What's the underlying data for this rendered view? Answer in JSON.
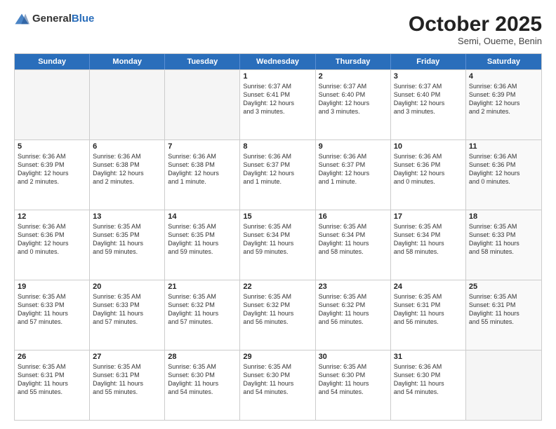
{
  "header": {
    "logo": {
      "general": "General",
      "blue": "Blue"
    },
    "month": "October 2025",
    "location": "Semi, Oueme, Benin"
  },
  "weekdays": [
    "Sunday",
    "Monday",
    "Tuesday",
    "Wednesday",
    "Thursday",
    "Friday",
    "Saturday"
  ],
  "rows": [
    [
      {
        "day": "",
        "empty": true,
        "info": ""
      },
      {
        "day": "",
        "empty": true,
        "info": ""
      },
      {
        "day": "",
        "empty": true,
        "info": ""
      },
      {
        "day": "1",
        "empty": false,
        "info": "Sunrise: 6:37 AM\nSunset: 6:41 PM\nDaylight: 12 hours\nand 3 minutes."
      },
      {
        "day": "2",
        "empty": false,
        "info": "Sunrise: 6:37 AM\nSunset: 6:40 PM\nDaylight: 12 hours\nand 3 minutes."
      },
      {
        "day": "3",
        "empty": false,
        "info": "Sunrise: 6:37 AM\nSunset: 6:40 PM\nDaylight: 12 hours\nand 3 minutes."
      },
      {
        "day": "4",
        "empty": false,
        "shade": true,
        "info": "Sunrise: 6:36 AM\nSunset: 6:39 PM\nDaylight: 12 hours\nand 2 minutes."
      }
    ],
    [
      {
        "day": "5",
        "empty": false,
        "info": "Sunrise: 6:36 AM\nSunset: 6:39 PM\nDaylight: 12 hours\nand 2 minutes."
      },
      {
        "day": "6",
        "empty": false,
        "info": "Sunrise: 6:36 AM\nSunset: 6:38 PM\nDaylight: 12 hours\nand 2 minutes."
      },
      {
        "day": "7",
        "empty": false,
        "info": "Sunrise: 6:36 AM\nSunset: 6:38 PM\nDaylight: 12 hours\nand 1 minute."
      },
      {
        "day": "8",
        "empty": false,
        "info": "Sunrise: 6:36 AM\nSunset: 6:37 PM\nDaylight: 12 hours\nand 1 minute."
      },
      {
        "day": "9",
        "empty": false,
        "info": "Sunrise: 6:36 AM\nSunset: 6:37 PM\nDaylight: 12 hours\nand 1 minute."
      },
      {
        "day": "10",
        "empty": false,
        "info": "Sunrise: 6:36 AM\nSunset: 6:36 PM\nDaylight: 12 hours\nand 0 minutes."
      },
      {
        "day": "11",
        "empty": false,
        "shade": true,
        "info": "Sunrise: 6:36 AM\nSunset: 6:36 PM\nDaylight: 12 hours\nand 0 minutes."
      }
    ],
    [
      {
        "day": "12",
        "empty": false,
        "info": "Sunrise: 6:36 AM\nSunset: 6:36 PM\nDaylight: 12 hours\nand 0 minutes."
      },
      {
        "day": "13",
        "empty": false,
        "info": "Sunrise: 6:35 AM\nSunset: 6:35 PM\nDaylight: 11 hours\nand 59 minutes."
      },
      {
        "day": "14",
        "empty": false,
        "info": "Sunrise: 6:35 AM\nSunset: 6:35 PM\nDaylight: 11 hours\nand 59 minutes."
      },
      {
        "day": "15",
        "empty": false,
        "info": "Sunrise: 6:35 AM\nSunset: 6:34 PM\nDaylight: 11 hours\nand 59 minutes."
      },
      {
        "day": "16",
        "empty": false,
        "info": "Sunrise: 6:35 AM\nSunset: 6:34 PM\nDaylight: 11 hours\nand 58 minutes."
      },
      {
        "day": "17",
        "empty": false,
        "info": "Sunrise: 6:35 AM\nSunset: 6:34 PM\nDaylight: 11 hours\nand 58 minutes."
      },
      {
        "day": "18",
        "empty": false,
        "shade": true,
        "info": "Sunrise: 6:35 AM\nSunset: 6:33 PM\nDaylight: 11 hours\nand 58 minutes."
      }
    ],
    [
      {
        "day": "19",
        "empty": false,
        "info": "Sunrise: 6:35 AM\nSunset: 6:33 PM\nDaylight: 11 hours\nand 57 minutes."
      },
      {
        "day": "20",
        "empty": false,
        "info": "Sunrise: 6:35 AM\nSunset: 6:33 PM\nDaylight: 11 hours\nand 57 minutes."
      },
      {
        "day": "21",
        "empty": false,
        "info": "Sunrise: 6:35 AM\nSunset: 6:32 PM\nDaylight: 11 hours\nand 57 minutes."
      },
      {
        "day": "22",
        "empty": false,
        "info": "Sunrise: 6:35 AM\nSunset: 6:32 PM\nDaylight: 11 hours\nand 56 minutes."
      },
      {
        "day": "23",
        "empty": false,
        "info": "Sunrise: 6:35 AM\nSunset: 6:32 PM\nDaylight: 11 hours\nand 56 minutes."
      },
      {
        "day": "24",
        "empty": false,
        "info": "Sunrise: 6:35 AM\nSunset: 6:31 PM\nDaylight: 11 hours\nand 56 minutes."
      },
      {
        "day": "25",
        "empty": false,
        "shade": true,
        "info": "Sunrise: 6:35 AM\nSunset: 6:31 PM\nDaylight: 11 hours\nand 55 minutes."
      }
    ],
    [
      {
        "day": "26",
        "empty": false,
        "info": "Sunrise: 6:35 AM\nSunset: 6:31 PM\nDaylight: 11 hours\nand 55 minutes."
      },
      {
        "day": "27",
        "empty": false,
        "info": "Sunrise: 6:35 AM\nSunset: 6:31 PM\nDaylight: 11 hours\nand 55 minutes."
      },
      {
        "day": "28",
        "empty": false,
        "info": "Sunrise: 6:35 AM\nSunset: 6:30 PM\nDaylight: 11 hours\nand 54 minutes."
      },
      {
        "day": "29",
        "empty": false,
        "info": "Sunrise: 6:35 AM\nSunset: 6:30 PM\nDaylight: 11 hours\nand 54 minutes."
      },
      {
        "day": "30",
        "empty": false,
        "info": "Sunrise: 6:35 AM\nSunset: 6:30 PM\nDaylight: 11 hours\nand 54 minutes."
      },
      {
        "day": "31",
        "empty": false,
        "info": "Sunrise: 6:36 AM\nSunset: 6:30 PM\nDaylight: 11 hours\nand 54 minutes."
      },
      {
        "day": "",
        "empty": true,
        "info": ""
      }
    ]
  ]
}
